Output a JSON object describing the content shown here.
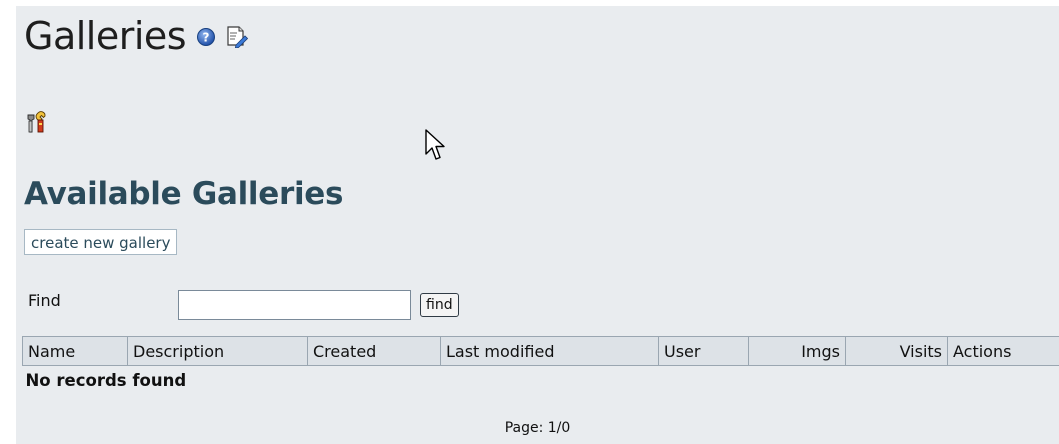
{
  "page": {
    "title": "Galleries",
    "help_icon": "help-question-icon",
    "edit_icon": "edit-page-icon",
    "admin_icon": "admin-tools-icon"
  },
  "section": {
    "title": "Available Galleries",
    "create_label": "create new gallery"
  },
  "search": {
    "label": "Find",
    "value": "",
    "placeholder": "",
    "button_label": "find"
  },
  "table": {
    "columns": [
      "Name",
      "Description",
      "Created",
      "Last modified",
      "User",
      "Imgs",
      "Visits",
      "Actions"
    ],
    "empty_message": "No records found"
  },
  "pagination": {
    "text": "Page: 1/0"
  },
  "colors": {
    "panel_background": "#e9ecef",
    "section_title": "#2b4b5b",
    "header_background": "#dde2e7"
  }
}
